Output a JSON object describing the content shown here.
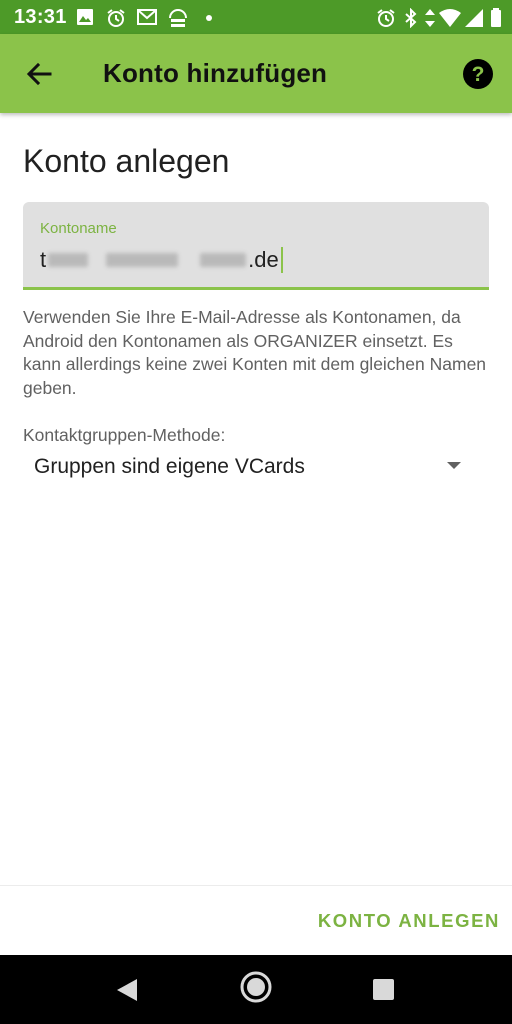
{
  "status_bar": {
    "time": "13:31",
    "left_icons": [
      "image-icon",
      "alarm-icon",
      "gmail-icon",
      "dav-sync-icon",
      "dot-icon"
    ],
    "right_icons": [
      "alarm-icon",
      "bluetooth-icon",
      "data-arrows-icon",
      "wifi-icon",
      "signal-icon",
      "battery-icon"
    ]
  },
  "app_bar": {
    "title": "Konto hinzufügen",
    "back_icon": "arrow-back-icon",
    "help_icon": "help-circle-icon"
  },
  "form": {
    "heading": "Konto anlegen",
    "account_name": {
      "label": "Kontoname",
      "value_prefix": "t",
      "value_suffix": ".de"
    },
    "help_text": "Verwenden Sie Ihre E-Mail-Adresse als Kontonamen, da Android den Kontonamen als ORGANIZER einsetzt. Es kann allerdings keine zwei Konten mit dem gleichen Namen geben.",
    "group_method": {
      "label": "Kontaktgruppen-Methode:",
      "selected": "Gruppen sind eigene VCards"
    }
  },
  "actions": {
    "create_label": "KONTO ANLEGEN"
  },
  "colors": {
    "status_bar": "#4d9a28",
    "app_bar": "#8bc34a",
    "accent": "#7cb342"
  }
}
